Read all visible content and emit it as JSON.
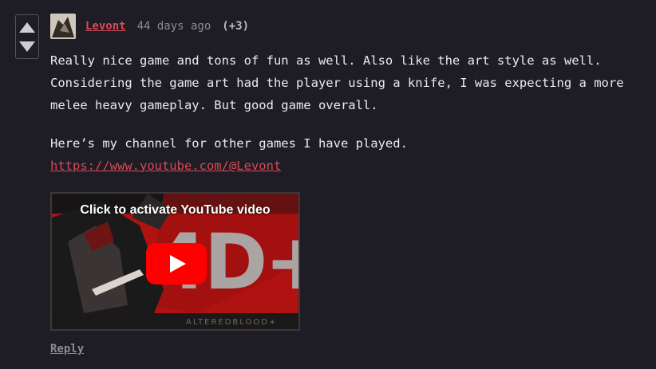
{
  "comment": {
    "author": "Levont",
    "age": "44 days ago",
    "score": "(+3)",
    "paragraphs": [
      "Really nice game and tons of fun as well. Also like the art style as well. Considering the game art had the player using a knife, I was expecting a more melee heavy gameplay. But good game overall.",
      "Here’s my channel for other games I have played."
    ],
    "link_text": "https://www.youtube.com/@Levont",
    "reply_label": "Reply"
  },
  "video": {
    "caption": "Click to activate YouTube video",
    "thumbnail_text": "4D+",
    "thumbnail_subtext": "ALTEREDBLOOD+"
  },
  "colors": {
    "background": "#1e1c24",
    "accent": "#d94a55",
    "muted": "#8d8a94",
    "text": "#ece9f2",
    "youtube_red": "#ff0000"
  },
  "icons": {
    "upvote": "triangle-up-icon",
    "downvote": "triangle-down-icon",
    "play": "youtube-play-icon"
  }
}
